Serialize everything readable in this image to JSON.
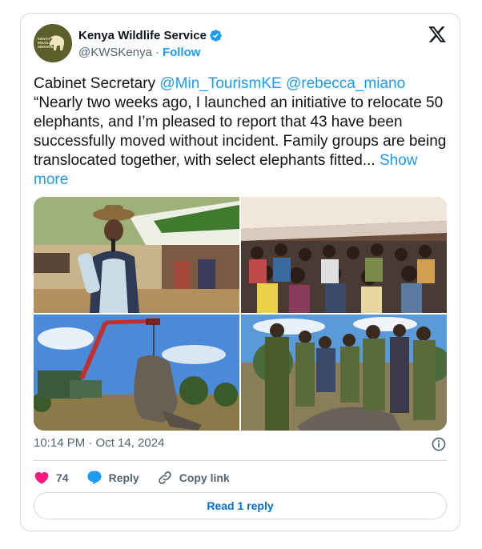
{
  "author": {
    "display_name": "Kenya Wildlife Service",
    "handle": "@KWSKenya",
    "separator": "·",
    "follow_label": "Follow",
    "avatar_text": "KENYA WILDLIFE SERVICE",
    "verified_icon": "verified-badge-icon"
  },
  "tweet": {
    "prefix": "Cabinet Secretary ",
    "mention1": "@Min_TourismKE",
    "mention_gap": " ",
    "mention2": "@rebecca_miano",
    "body": "“Nearly two weeks ago, I launched an initiative to relocate 50 elephants, and I’m pleased to report that 43 have been successfully moved without incident. Family groups are being translocated together, with select elephants fitted...",
    "show_more": "Show more"
  },
  "timestamp": "10:14 PM · Oct 14, 2024",
  "actions": {
    "like_count": "74",
    "reply_label": "Reply",
    "copy_label": "Copy link"
  },
  "read_reply_label": "Read 1 reply",
  "colors": {
    "accent": "#1d9bf0",
    "like": "#f91880",
    "muted": "#536471",
    "border": "#cfd9de"
  }
}
